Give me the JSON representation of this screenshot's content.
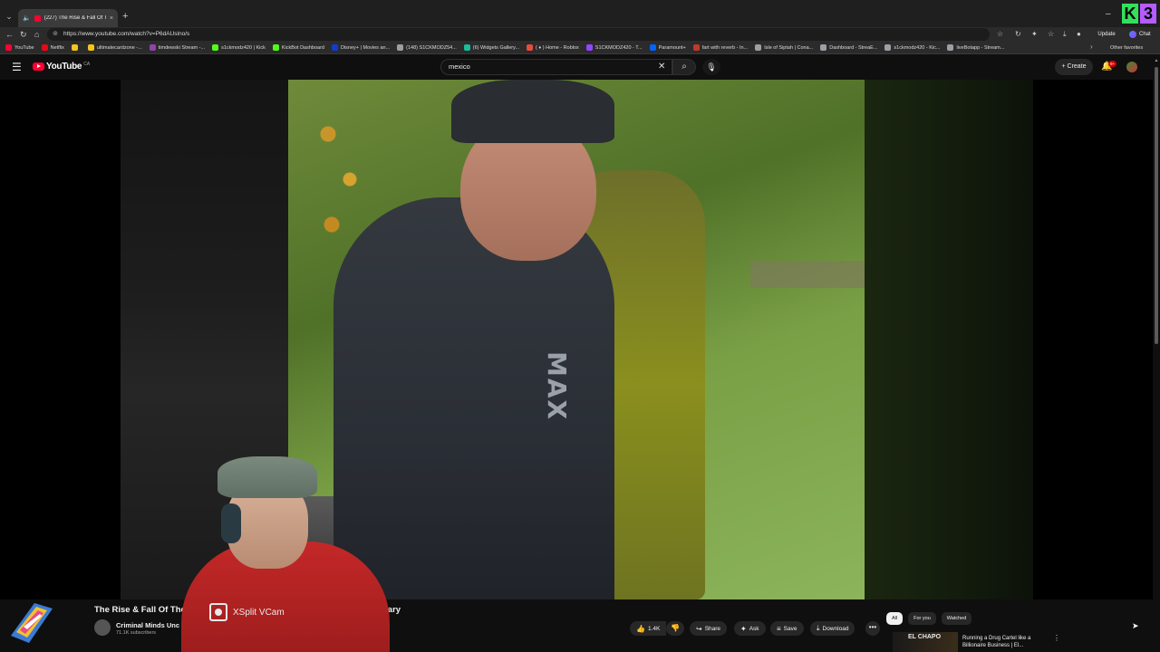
{
  "browser": {
    "tab": {
      "title": "(227) The Rise & Fall Of The",
      "close": "×"
    },
    "new_tab": "+",
    "minimize": "–",
    "address": "https://www.youtube.com/watch?v=P6dAUslno/s",
    "update_label": "Update",
    "chat_label": "Chat",
    "bookmarks": [
      {
        "label": "YouTube",
        "color": "#ff0033"
      },
      {
        "label": "Netflix",
        "color": "#e50914"
      },
      {
        "label": "",
        "color": "#f5c518"
      },
      {
        "label": "ultimatecardzone -...",
        "color": "#f5c518"
      },
      {
        "label": "timdewski Stream -...",
        "color": "#8e44ad"
      },
      {
        "label": "s1ckmodz420 | Kick",
        "color": "#53fc18"
      },
      {
        "label": "KickBot Dashboard",
        "color": "#53fc18"
      },
      {
        "label": "Disney+ | Movies an...",
        "color": "#113ccf"
      },
      {
        "label": "(148) S1CKMODZ54...",
        "color": "#9aa0a6"
      },
      {
        "label": "(6) Widgets Gallery...",
        "color": "#1abc9c"
      },
      {
        "label": "( ♦ ) Home - Roblox",
        "color": "#e74c3c"
      },
      {
        "label": "S1CKMODZ420 - T...",
        "color": "#9146ff"
      },
      {
        "label": "Paramount+",
        "color": "#0064ff"
      },
      {
        "label": "fart with reverb - In...",
        "color": "#c0392b"
      },
      {
        "label": "Isle of Siptah | Cona...",
        "color": "#9aa0a6"
      },
      {
        "label": "Dashboard - StreaE...",
        "color": "#9aa0a6"
      },
      {
        "label": "s1ckmodz420 - Kic...",
        "color": "#9aa0a6"
      },
      {
        "label": "liveBotapp - Stream...",
        "color": "#9aa0a6"
      }
    ],
    "other_favorites": "Other favorites"
  },
  "youtube": {
    "logo_word": "YouTube",
    "logo_region": "CA",
    "search_value": "mexico",
    "create_label": "Create",
    "notifications_badge": "9+",
    "video": {
      "title_start": "The Rise & Fall Of The",
      "title_end": "cumentary",
      "channel_name": "Criminal Minds Unc",
      "subscribers": "71.1K subscribers",
      "hoodie_text": "MAX"
    },
    "actions": {
      "likes": "1.4K",
      "share": "Share",
      "ask": "Ask",
      "save": "Save",
      "download": "Download",
      "more": "•••"
    },
    "chips": [
      "All",
      "For you",
      "Watched"
    ],
    "recommendation": {
      "thumb_text": "EL CHAPO",
      "title": "Running a Drug Cartel like a Billionaire Business | El...",
      "menu": "⋮"
    }
  },
  "overlay": {
    "xsplit_label": "XSplit VCam"
  }
}
